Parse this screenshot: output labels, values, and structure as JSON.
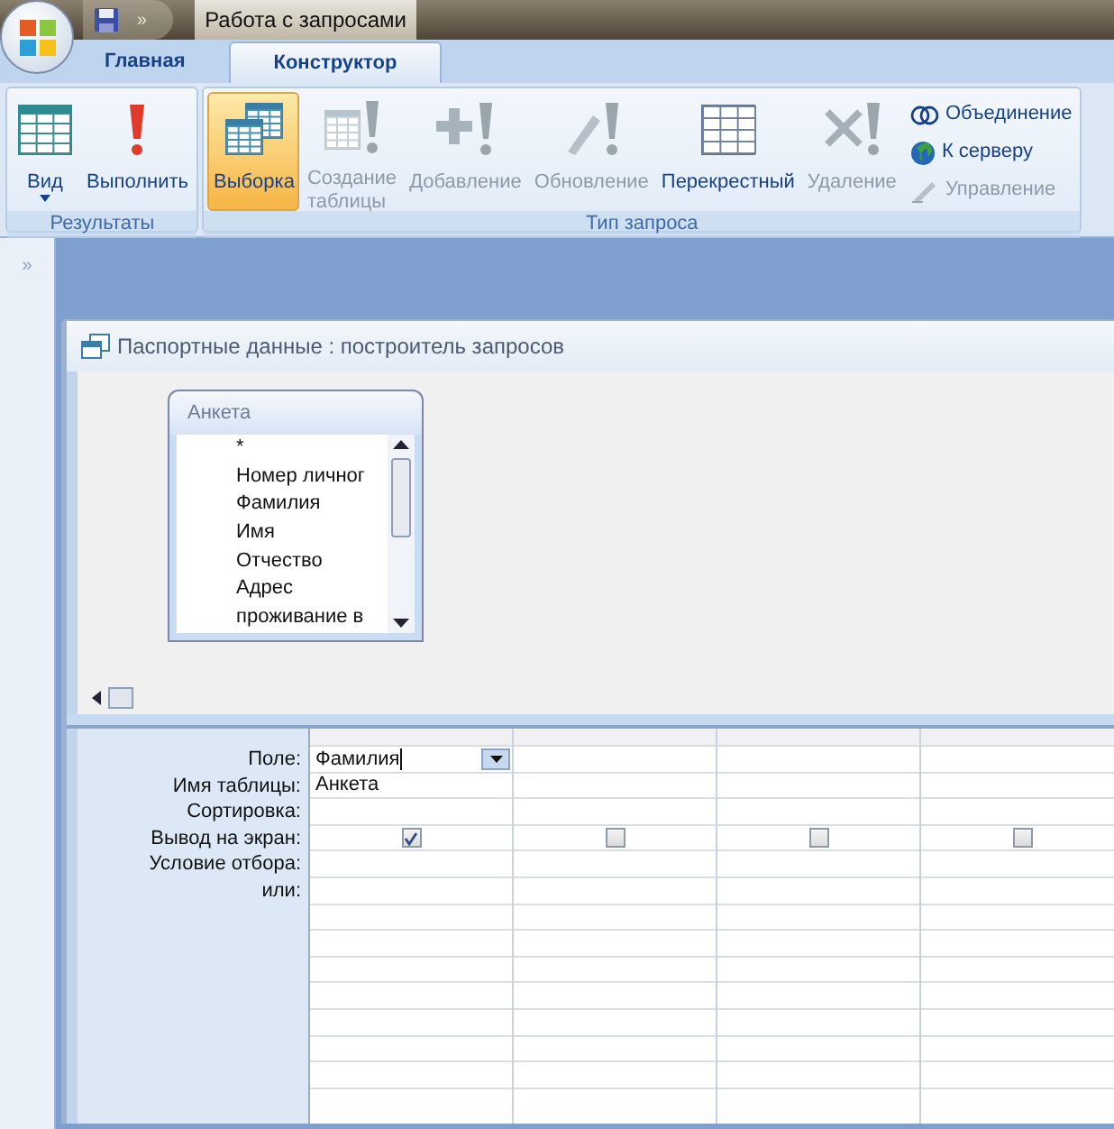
{
  "window": {
    "title": "Работа с запросами",
    "quick_access": "»"
  },
  "tabs": [
    {
      "label": "Главная",
      "selected": false
    },
    {
      "label": "Конструктор",
      "selected": true
    }
  ],
  "ribbon": [
    {
      "label": "Результаты",
      "buttons": [
        {
          "kind": "large",
          "label": "Вид",
          "dropdown": true,
          "disabled": false,
          "selected": false
        },
        {
          "kind": "large",
          "label": "Выполнить",
          "dropdown": false,
          "disabled": false,
          "selected": false
        }
      ]
    },
    {
      "label": "Тип запроса",
      "buttons": [
        {
          "kind": "large",
          "label": "Выборка",
          "dropdown": false,
          "disabled": false,
          "selected": true
        },
        {
          "kind": "large",
          "label": "Создание\nтаблицы",
          "dropdown": false,
          "disabled": true,
          "selected": false
        },
        {
          "kind": "large",
          "label": "Добавление",
          "dropdown": false,
          "disabled": true,
          "selected": false
        },
        {
          "kind": "large",
          "label": "Обновление",
          "dropdown": false,
          "disabled": true,
          "selected": false
        },
        {
          "kind": "large",
          "label": "Перекрестный",
          "dropdown": false,
          "disabled": false,
          "selected": false
        },
        {
          "kind": "large",
          "label": "Удаление",
          "dropdown": false,
          "disabled": true,
          "selected": false
        },
        {
          "kind": "small",
          "label": "Объединение",
          "dropdown": false,
          "disabled": false,
          "selected": false
        },
        {
          "kind": "small",
          "label": "К серверу",
          "dropdown": false,
          "disabled": false,
          "selected": false
        },
        {
          "kind": "small",
          "label": "Управление",
          "dropdown": false,
          "disabled": true,
          "selected": false
        }
      ]
    }
  ],
  "nav_pane": {
    "toggle": "»"
  },
  "query_window": {
    "title": "Паспортные данные : построитель запросов",
    "table": {
      "name": "Анкета",
      "fields": [
        "*",
        "Номер личног",
        "Фамилия",
        "Имя",
        "Отчество",
        "Адрес",
        "проживание в"
      ]
    },
    "grid": {
      "row_labels": [
        "Поле:",
        "Имя таблицы:",
        "Сортировка:",
        "Вывод на экран:",
        "Условие отбора:",
        "или:"
      ],
      "columns": [
        {
          "field": "Фамилия",
          "table": "Анкета",
          "show": true,
          "active": true
        },
        {
          "show": false,
          "active": false
        },
        {
          "show": false,
          "active": false
        },
        {
          "show": false,
          "active": false
        }
      ]
    }
  }
}
